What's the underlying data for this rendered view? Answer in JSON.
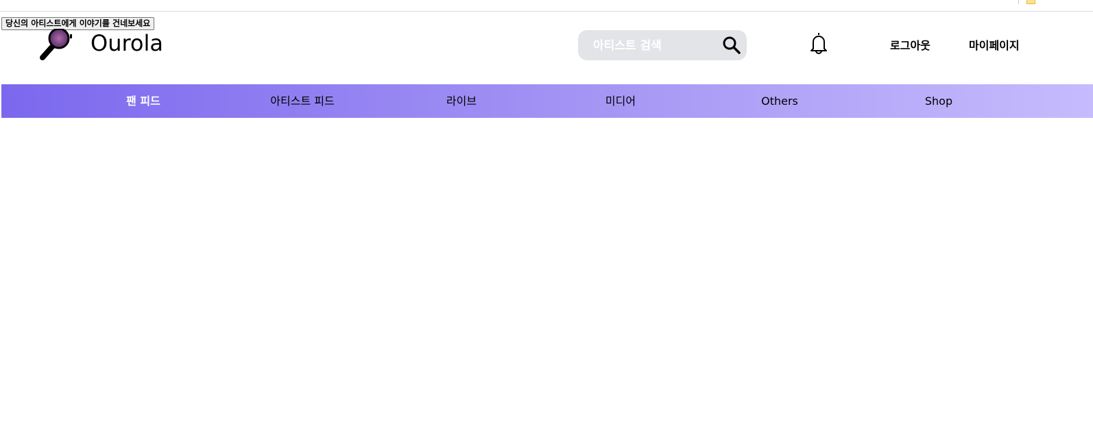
{
  "header": {
    "story_button": "당신의 아티스트에게 이야기를 건네보세요",
    "logo_text": "Ourola",
    "search": {
      "placeholder": "아티스트 검색",
      "value": ""
    },
    "logout": "로그아웃",
    "mypage": "마이페이지"
  },
  "nav": {
    "items": [
      {
        "label": "팬 피드",
        "active": true
      },
      {
        "label": "아티스트 피드"
      },
      {
        "label": "라이브"
      },
      {
        "label": "미디어"
      },
      {
        "label": "Others"
      },
      {
        "label": "Shop"
      }
    ],
    "gradient": [
      "#7b68ee",
      "#c6bbfd"
    ]
  }
}
